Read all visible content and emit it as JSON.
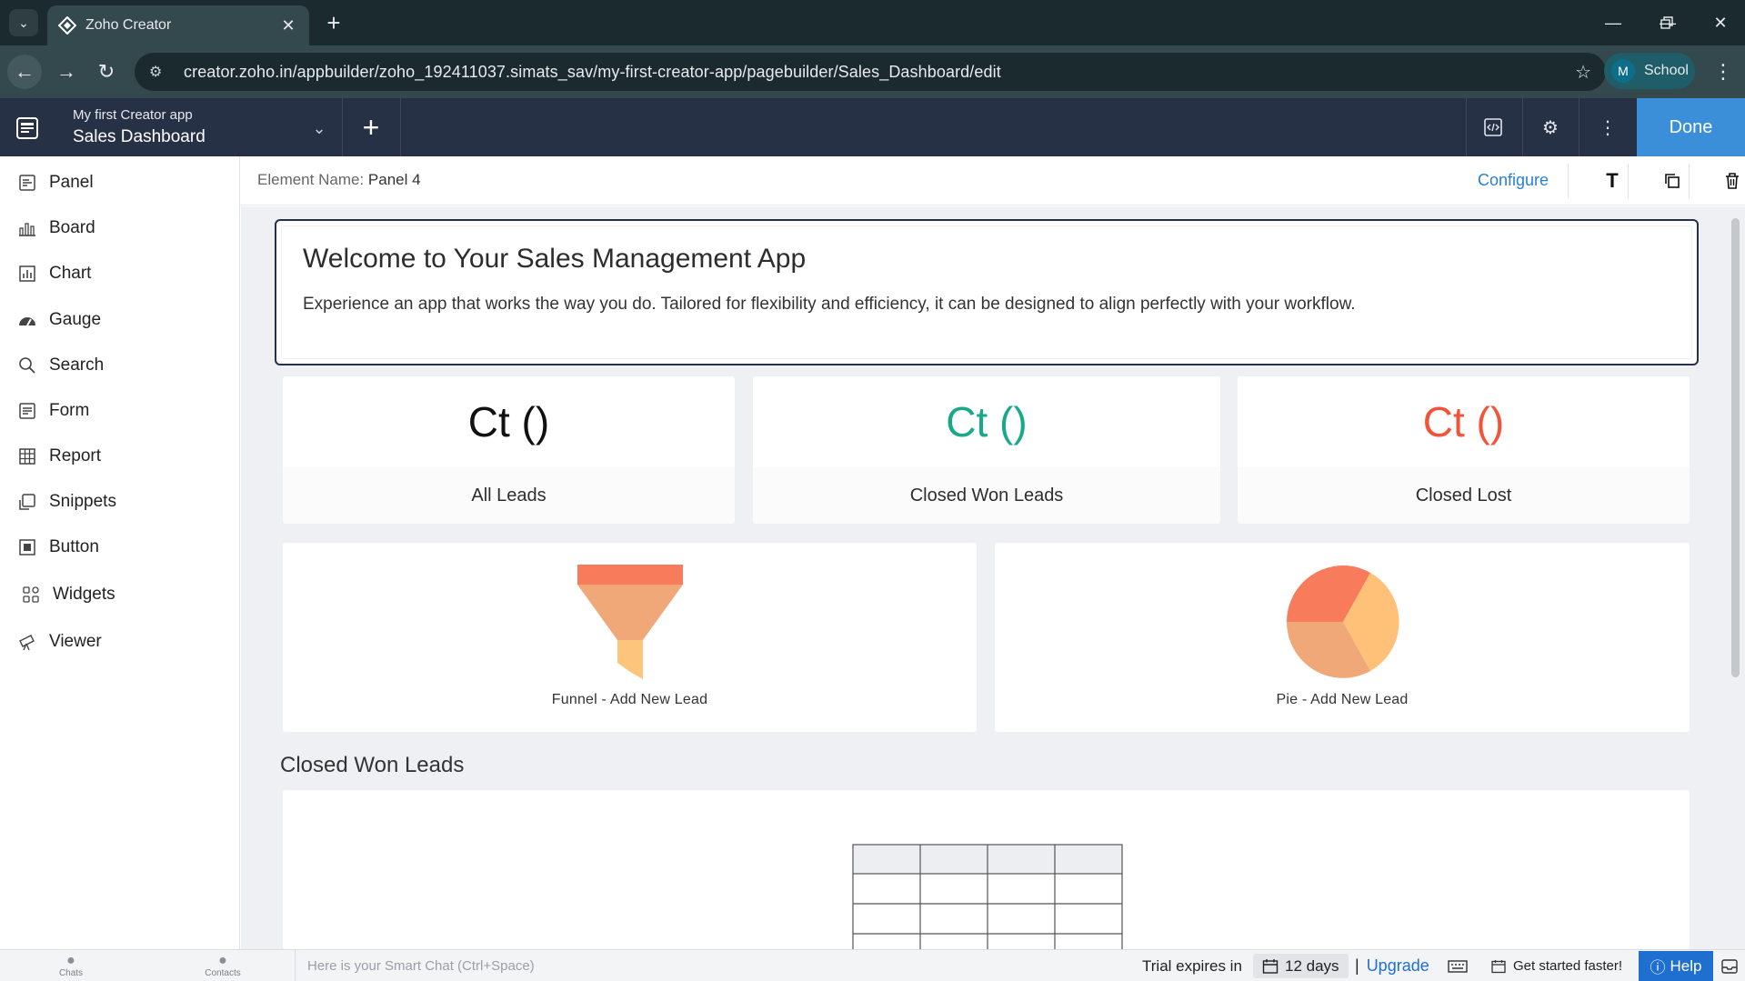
{
  "browser": {
    "tab_title": "Zoho Creator",
    "url": "creator.zoho.in/appbuilder/zoho_192411037.simats_sav/my-first-creator-app/pagebuilder/Sales_Dashboard/edit",
    "profile_initial": "M",
    "profile_name": "School"
  },
  "app_header": {
    "app_name": "My first Creator app",
    "page_name": "Sales Dashboard",
    "done_label": "Done"
  },
  "sidebar": {
    "items": [
      {
        "label": "Panel",
        "icon": "panel-icon"
      },
      {
        "label": "Board",
        "icon": "board-icon"
      },
      {
        "label": "Chart",
        "icon": "chart-icon"
      },
      {
        "label": "Gauge",
        "icon": "gauge-icon"
      },
      {
        "label": "Search",
        "icon": "search-icon"
      },
      {
        "label": "Form",
        "icon": "form-icon"
      },
      {
        "label": "Report",
        "icon": "report-icon"
      },
      {
        "label": "Snippets",
        "icon": "snippets-icon"
      },
      {
        "label": "Button",
        "icon": "button-icon"
      },
      {
        "label": "Widgets",
        "icon": "widgets-icon"
      },
      {
        "label": "Viewer",
        "icon": "viewer-icon"
      }
    ]
  },
  "element_bar": {
    "label": "Element Name:",
    "value": "Panel 4",
    "configure_label": "Configure",
    "text_tool": "T"
  },
  "welcome": {
    "title": "Welcome to Your Sales Management App",
    "text": "Experience an app that works the way you do. Tailored for flexibility and efficiency, it can be designed to align perfectly with your workflow."
  },
  "stats": [
    {
      "value": "Ct ()",
      "label": "All Leads",
      "color": "#111111"
    },
    {
      "value": "Ct ()",
      "label": "Closed Won Leads",
      "color": "#19a98a"
    },
    {
      "value": "Ct ()",
      "label": "Closed Lost",
      "color": "#f4533a"
    }
  ],
  "charts": {
    "funnel_label": "Funnel - Add New Lead",
    "pie_label": "Pie - Add New Lead"
  },
  "section": {
    "title": "Closed Won Leads"
  },
  "statusbar": {
    "chats": "Chats",
    "contacts": "Contacts",
    "smart_chat": "Here is your Smart Chat (Ctrl+Space)",
    "trial_text": "Trial expires in",
    "days": "12 days",
    "upgrade": "Upgrade",
    "get_started": "Get started faster!",
    "help": "Help"
  },
  "colors": {
    "header_bg": "#273146",
    "done_bg": "#3b8fd9",
    "link": "#2a7fd4",
    "funnel_top": "#f87c5c",
    "funnel_mid": "#f0a878",
    "funnel_bottom": "#fdc57c",
    "pie_a": "#f87c5c",
    "pie_b": "#ffc078",
    "pie_c": "#f0a878"
  }
}
